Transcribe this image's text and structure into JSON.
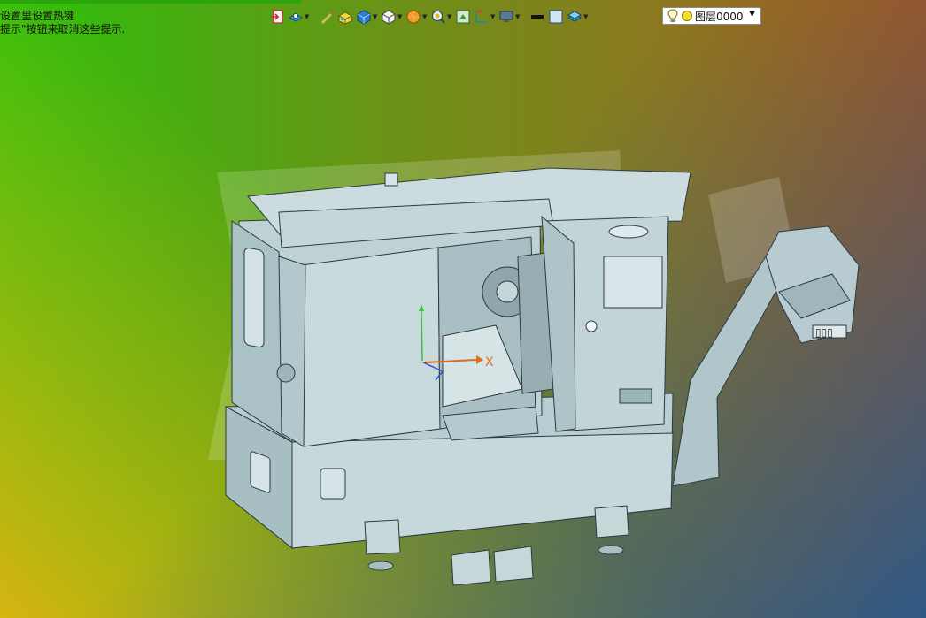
{
  "hints": {
    "line1": "设置里设置热键",
    "line2": "提示\"按钮来取消这些提示."
  },
  "toolbar": {
    "tools": [
      {
        "icon": "exit-icon",
        "dropdown": false
      },
      {
        "icon": "view-orient-icon",
        "dropdown": true
      },
      {
        "icon": "sketch-pencil-icon",
        "dropdown": false
      },
      {
        "icon": "box-feature-icon",
        "dropdown": false
      },
      {
        "icon": "solid-cube-icon",
        "dropdown": true
      },
      {
        "icon": "wire-cube-icon",
        "dropdown": true
      },
      {
        "icon": "render-sphere-icon",
        "dropdown": true
      },
      {
        "icon": "zoom-icon",
        "dropdown": true
      },
      {
        "icon": "fit-view-icon",
        "dropdown": false
      },
      {
        "icon": "section-icon",
        "dropdown": true
      },
      {
        "icon": "display-icon",
        "dropdown": true
      },
      {
        "icon": "line-color-icon",
        "dropdown": false
      },
      {
        "icon": "face-color-icon",
        "dropdown": false
      },
      {
        "icon": "layers-icon",
        "dropdown": true
      }
    ],
    "layer_select": {
      "value": "图层0000"
    }
  },
  "colors": {
    "machine_body": "#b9cdd1",
    "machine_edge": "#2c3a3e",
    "axis_x": "#e46a16",
    "axis_y": "#3fbf3f",
    "axis_z": "#3050d0"
  },
  "viewport": {
    "axis_label_x": "X"
  }
}
